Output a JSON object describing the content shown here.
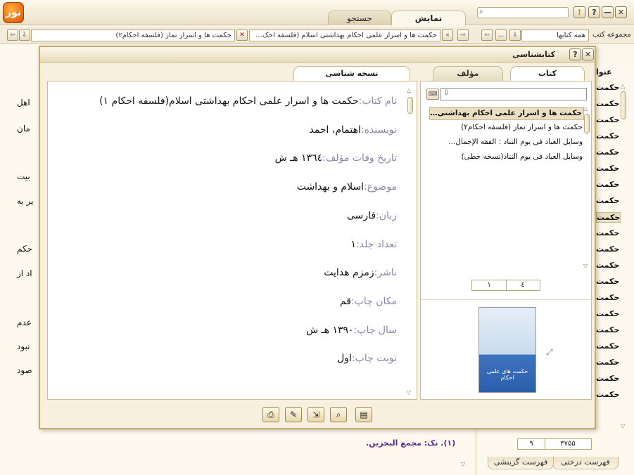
{
  "app": {
    "logo_text": "نور",
    "tabs": [
      {
        "label": "نمایش",
        "active": true
      },
      {
        "label": "جستجو",
        "active": false
      }
    ],
    "search_value": "",
    "window_buttons": {
      "help": "?",
      "minimize": "—",
      "close": "✕",
      "warning": "!"
    }
  },
  "toolbar": {
    "title_field": "حکمت ها و اسرار علمی احکام بهداشتی اسلام (فلسفه احک...",
    "nav_field": "حکمت ها و اسرار نماز (فلسفه احکام۲)",
    "collection_label": "مجموعه کتب",
    "collection_value": "همه کتابها",
    "more": "..."
  },
  "background": {
    "lines": [
      "اهل",
      "مان",
      "بیت",
      "یر به",
      "حکم",
      "اد از",
      "عدم",
      "نبود",
      "صود"
    ],
    "footnote": "(۱). نک: مجمع البحرین.",
    "list_header": "عنوا",
    "list_items": [
      "حکمت",
      "حکمت",
      "حکمت",
      "حکمت",
      "حکمت",
      "حکمت",
      "حکمت",
      "حکمت",
      "حکمت",
      "حکمت",
      "حکمت",
      "حکمت",
      "حکمت",
      "حکمت",
      "حکمت",
      "حکمت",
      "حکمت",
      "حکمت",
      "حکمت",
      "حکمت"
    ],
    "pager_current": "۹",
    "pager_total": "۳۷۵۵",
    "bottom_tabs": [
      "فهرست درختی",
      "فهرست گزینشی"
    ]
  },
  "dialog": {
    "title": "کتابشناسی",
    "help": "?",
    "close": "✕",
    "right_tabs": [
      {
        "label": "کتاب",
        "active": true
      },
      {
        "label": "مؤلف",
        "active": false
      }
    ],
    "left_tab": "نسخه شناسی",
    "search_value": "",
    "books": [
      {
        "title": "حکمت ها و اسرار علمی احکام بهداشتی ا...",
        "selected": true
      },
      {
        "title": "حکمت ها و اسرار نماز (فلسفه احکام۲)",
        "selected": false
      },
      {
        "title": "وسایل العباد فی یوم التناد : الفقه الإجمال...",
        "selected": false
      },
      {
        "title": "وسایل العباد فی یوم التناد(نسخه خطی)",
        "selected": false
      }
    ],
    "book_pager": {
      "current": "۱",
      "total": "٤"
    },
    "meta": [
      {
        "label": "نام کتاب:",
        "value": "حکمت ها و اسرار علمی احکام بهداشتی اسلام(فلسفه احکام ۱)"
      },
      {
        "label": "نویسنده:",
        "value": "اهتمام، احمد"
      },
      {
        "label": "تاریخ وفات مؤلف:",
        "value": "۱۳٦٤ هـ ش"
      },
      {
        "label": "موضوع:",
        "value": "اسلام و بهداشت"
      },
      {
        "label": "زبان:",
        "value": "فارسی"
      },
      {
        "label": "تعداد جلد:",
        "value": "۱"
      },
      {
        "label": "ناشر:",
        "value": "زمزم هدایت"
      },
      {
        "label": "مکان چاپ:",
        "value": "قم"
      },
      {
        "label": "سال چاپ:",
        "value": "۱۳۹۰ هـ ش"
      },
      {
        "label": "نوبت چاپ:",
        "value": "اول"
      }
    ],
    "cover_text": "حکمت های علمی احکام",
    "footer_buttons": [
      "print-icon",
      "edit-icon",
      "export-icon",
      "search-icon",
      "note-icon"
    ]
  }
}
